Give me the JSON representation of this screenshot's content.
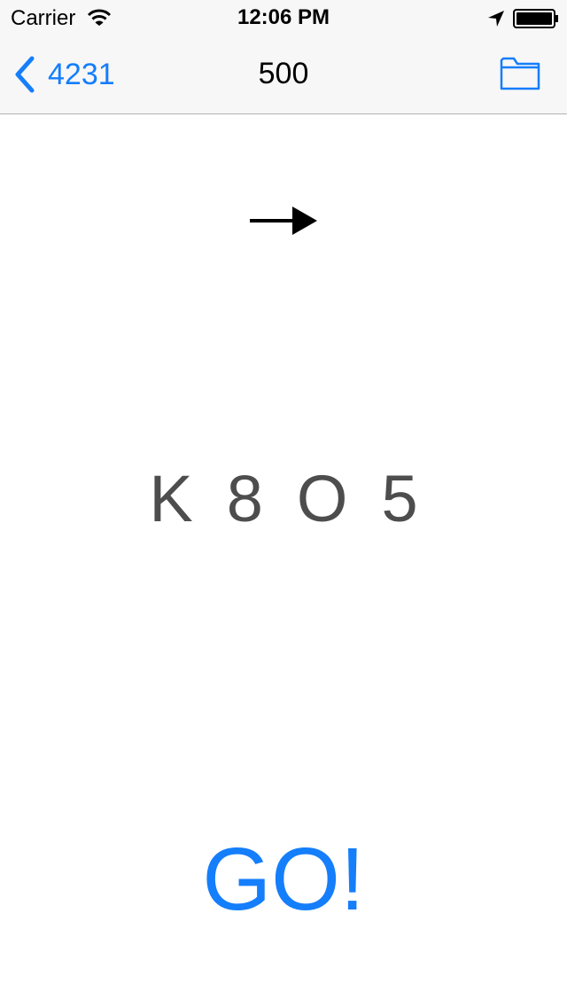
{
  "status_bar": {
    "carrier": "Carrier",
    "time": "12:06 PM",
    "icons": [
      "wifi-icon",
      "location-arrow-icon",
      "battery-icon"
    ]
  },
  "nav_bar": {
    "back_label": "4231",
    "title": "500",
    "right_icon": "folder-icon"
  },
  "content": {
    "direction_icon": "arrow-right-icon",
    "characters": [
      "K",
      "8",
      "O",
      "5"
    ],
    "go_label": "GO!"
  },
  "colors": {
    "accent": "#157efb",
    "stimulus_text": "#4d4d4d",
    "nav_background": "#f7f7f7"
  }
}
